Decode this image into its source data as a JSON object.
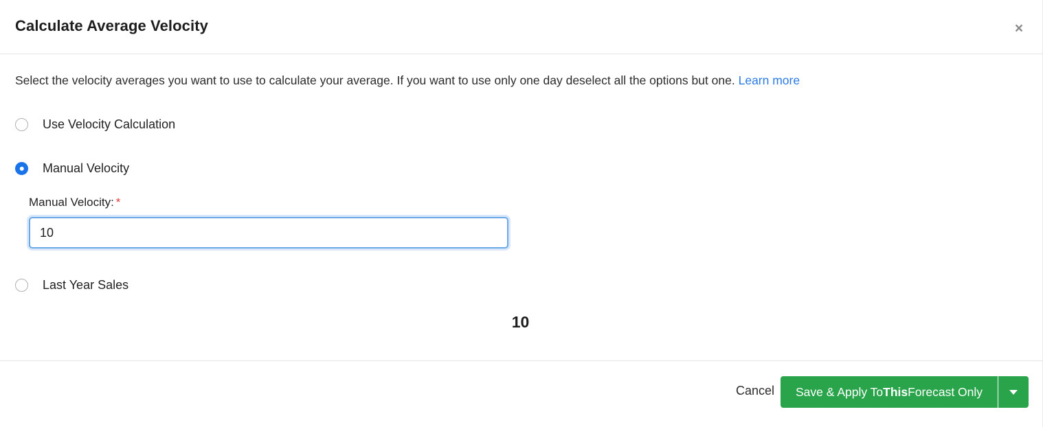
{
  "header": {
    "title": "Calculate Average Velocity",
    "close_label": "×"
  },
  "body": {
    "description_text": "Select the velocity averages you want to use to calculate your average. If you want to use only one day deselect all the options but one.",
    "learn_more_label": "Learn more",
    "options": [
      {
        "label": "Use Velocity Calculation",
        "selected": false
      },
      {
        "label": "Manual Velocity",
        "selected": true
      },
      {
        "label": "Last Year Sales",
        "selected": false
      }
    ],
    "field": {
      "label": "Manual Velocity:",
      "required_marker": "*",
      "value": "10",
      "placeholder": ""
    },
    "result_value": "10"
  },
  "footer": {
    "cancel_label": "Cancel",
    "primary_prefix": "Save & Apply To ",
    "primary_emphasis": "This",
    "primary_suffix": " Forecast Only",
    "dropdown_icon": "chevron-down-icon"
  },
  "colors": {
    "accent_blue": "#1a73e8",
    "link_blue": "#2a7ae4",
    "primary_green": "#2aa44a",
    "required_red": "#e03a3a",
    "focus_border": "#6aa8e8"
  }
}
